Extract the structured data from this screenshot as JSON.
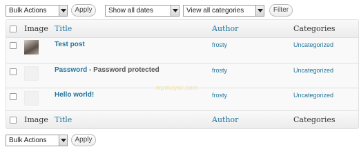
{
  "top_controls": {
    "bulk_actions": "Bulk Actions",
    "apply": "Apply",
    "date_filter": "Show all dates",
    "category_filter": "View all categories",
    "filter": "Filter"
  },
  "table": {
    "columns": {
      "image": "Image",
      "title": "Title",
      "author": "Author",
      "categories": "Categories"
    },
    "rows": [
      {
        "title": "Test post",
        "state": "",
        "author": "frosty",
        "category": "Uncategorized",
        "has_image": true
      },
      {
        "title": "Password",
        "state": " - Password protected",
        "author": "frosty",
        "category": "Uncategorized",
        "has_image": false
      },
      {
        "title": "Hello world!",
        "state": "",
        "author": "frosty",
        "category": "Uncategorized",
        "has_image": false
      }
    ]
  },
  "bottom_controls": {
    "bulk_actions": "Bulk Actions",
    "apply": "Apply"
  },
  "watermark": "wpmayor.com",
  "colors": {
    "link": "#21759b",
    "header_bg": "#f1f1f1",
    "row_bg": "#f9f9f9",
    "border": "#dfdfdf"
  }
}
